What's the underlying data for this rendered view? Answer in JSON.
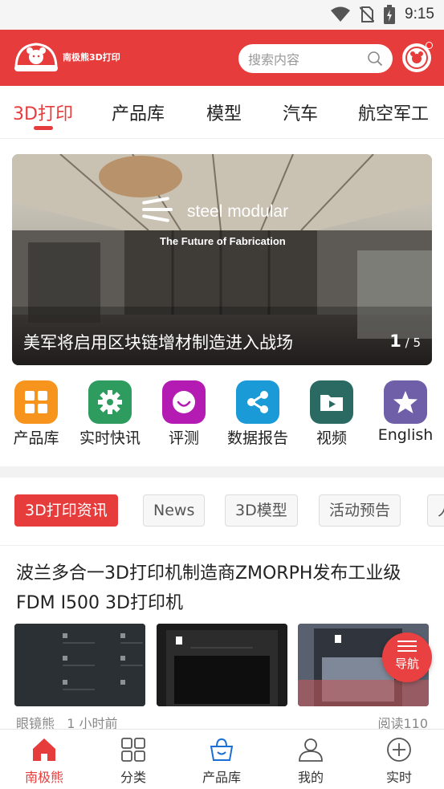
{
  "status_bar": {
    "time": "9:15",
    "icons": [
      "wifi-icon",
      "no-sim-icon",
      "battery-charging-icon"
    ]
  },
  "header": {
    "brand": "南极熊3D打印",
    "search_placeholder": "搜索内容",
    "accent_color": "#e63c3c"
  },
  "tabs": [
    {
      "label": "3D打印",
      "active": true
    },
    {
      "label": "产品库"
    },
    {
      "label": "模型"
    },
    {
      "label": "汽车"
    },
    {
      "label": "航空军工"
    }
  ],
  "banner": {
    "image_text_main": "steel modular",
    "image_text_sub": "The Future of Fabrication",
    "caption": "美军将启用区块链增材制造进入战场",
    "page_current": "1",
    "page_total": "/ 5"
  },
  "quick_links": [
    {
      "label": "产品库",
      "icon": "grid-icon",
      "color": "#f7941d"
    },
    {
      "label": "实时快讯",
      "icon": "gear-icon",
      "color": "#2e9c5e"
    },
    {
      "label": "评测",
      "icon": "smile-icon",
      "color": "#b31bb3"
    },
    {
      "label": "数据报告",
      "icon": "share-icon",
      "color": "#1a9bd7"
    },
    {
      "label": "视频",
      "icon": "video-folder-icon",
      "color": "#2a6a63"
    },
    {
      "label": "English",
      "icon": "star-icon",
      "color": "#6f5fa8"
    }
  ],
  "chips": [
    {
      "label": "3D打印资讯",
      "active": true
    },
    {
      "label": "News"
    },
    {
      "label": "3D模型"
    },
    {
      "label": "活动预告"
    },
    {
      "label": "人"
    }
  ],
  "article": {
    "title": "波兰多合一3D打印机制造商ZMORPH发布工业级FDM I500 3D打印机",
    "author": "眼镜熊",
    "time": "1 小时前",
    "reads": "阅读110"
  },
  "fab": {
    "label": "导航"
  },
  "bottom_nav": [
    {
      "label": "南极熊",
      "icon": "home-icon",
      "active": true
    },
    {
      "label": "分类",
      "icon": "category-grid-icon"
    },
    {
      "label": "产品库",
      "icon": "shopping-basket-icon"
    },
    {
      "label": "我的",
      "icon": "user-icon"
    },
    {
      "label": "实时",
      "icon": "plus-circle-icon"
    }
  ]
}
